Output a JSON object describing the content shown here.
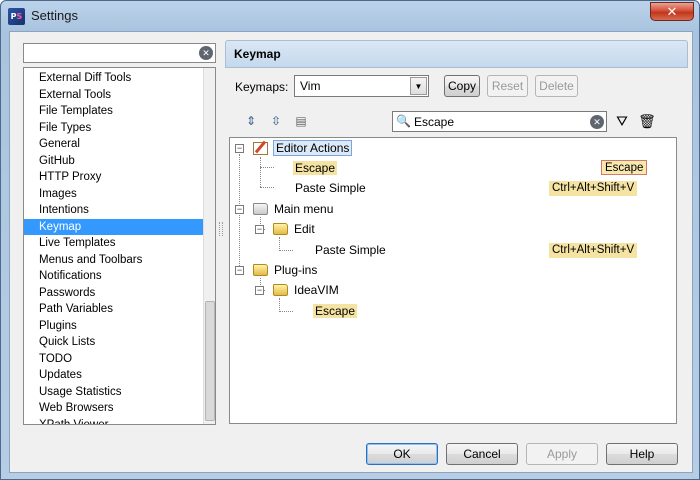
{
  "window": {
    "title": "Settings",
    "close_label": "✕"
  },
  "sidebar": {
    "search_value": "",
    "items": [
      {
        "label": "External Diff Tools"
      },
      {
        "label": "External Tools"
      },
      {
        "label": "File Templates"
      },
      {
        "label": "File Types"
      },
      {
        "label": "General"
      },
      {
        "label": "GitHub"
      },
      {
        "label": "HTTP Proxy"
      },
      {
        "label": "Images"
      },
      {
        "label": "Intentions"
      },
      {
        "label": "Keymap",
        "selected": true
      },
      {
        "label": "Live Templates"
      },
      {
        "label": "Menus and Toolbars"
      },
      {
        "label": "Notifications"
      },
      {
        "label": "Passwords"
      },
      {
        "label": "Path Variables"
      },
      {
        "label": "Plugins"
      },
      {
        "label": "Quick Lists"
      },
      {
        "label": "TODO"
      },
      {
        "label": "Updates"
      },
      {
        "label": "Usage Statistics"
      },
      {
        "label": "Web Browsers"
      },
      {
        "label": "XPath Viewer"
      }
    ]
  },
  "panel": {
    "title": "Keymap",
    "keymaps_label": "Keymaps:",
    "keymap_value": "Vim",
    "copy_label": "Copy",
    "reset_label": "Reset",
    "delete_label": "Delete",
    "search_value": "Escape"
  },
  "tree": {
    "editor_actions": "Editor Actions",
    "escape": "Escape",
    "escape_shortcut": "Escape",
    "paste_simple": "Paste Simple",
    "paste_simple_shortcut": "Ctrl+Alt+Shift+V",
    "main_menu": "Main menu",
    "edit": "Edit",
    "paste_simple_2": "Paste Simple",
    "paste_simple_2_shortcut": "Ctrl+Alt+Shift+V",
    "plugins": "Plug-ins",
    "ideavim": "IdeaVIM",
    "escape_2": "Escape"
  },
  "footer": {
    "ok_label": "OK",
    "cancel_label": "Cancel",
    "apply_label": "Apply",
    "help_label": "Help"
  },
  "icons": {
    "expand_all": "expand-all-icon",
    "collapse_all": "collapse-all-icon",
    "shortcut_search": "shortcut-search-icon",
    "filter": "filter-icon",
    "clear_filter": "clear-filter-icon"
  }
}
